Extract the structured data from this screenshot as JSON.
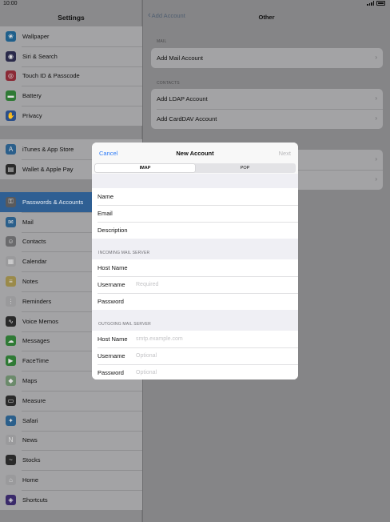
{
  "status": {
    "time": "10:00"
  },
  "sidebar": {
    "title": "Settings",
    "groups": [
      [
        {
          "label": "Wallpaper",
          "icon": "wallpaper-icon",
          "color": "#1f5f8b"
        },
        {
          "label": "Siri & Search",
          "icon": "siri-icon",
          "color": "#2a2a4a"
        },
        {
          "label": "Touch ID & Passcode",
          "icon": "fingerprint-icon",
          "color": "#8b2a36"
        },
        {
          "label": "Battery",
          "icon": "battery-icon",
          "color": "#2f7a35"
        },
        {
          "label": "Privacy",
          "icon": "hand-icon",
          "color": "#2b4f8b"
        }
      ],
      [
        {
          "label": "iTunes & App Store",
          "icon": "app-store-icon",
          "color": "#2b5f8b"
        },
        {
          "label": "Wallet & Apple Pay",
          "icon": "wallet-icon",
          "color": "#2a2a2a"
        }
      ],
      [
        {
          "label": "Passwords & Accounts",
          "icon": "key-icon",
          "color": "#5a5a5c"
        },
        {
          "label": "Mail",
          "icon": "mail-icon",
          "color": "#2b5f8b"
        },
        {
          "label": "Contacts",
          "icon": "contacts-icon",
          "color": "#6b6b6d"
        },
        {
          "label": "Calendar",
          "icon": "calendar-icon",
          "color": "#9a9a9c"
        },
        {
          "label": "Notes",
          "icon": "notes-icon",
          "color": "#9a8a4a"
        },
        {
          "label": "Reminders",
          "icon": "reminders-icon",
          "color": "#9a9a9c"
        },
        {
          "label": "Voice Memos",
          "icon": "voice-memos-icon",
          "color": "#2a2a2a"
        },
        {
          "label": "Messages",
          "icon": "messages-icon",
          "color": "#2f7a35"
        },
        {
          "label": "FaceTime",
          "icon": "facetime-icon",
          "color": "#2f7a35"
        },
        {
          "label": "Maps",
          "icon": "maps-icon",
          "color": "#6b8a6b"
        },
        {
          "label": "Measure",
          "icon": "measure-icon",
          "color": "#2a2a2a"
        },
        {
          "label": "Safari",
          "icon": "safari-icon",
          "color": "#2b5f8b"
        },
        {
          "label": "News",
          "icon": "news-icon",
          "color": "#9a9a9c"
        },
        {
          "label": "Stocks",
          "icon": "stocks-icon",
          "color": "#2a2a2a"
        },
        {
          "label": "Home",
          "icon": "home-icon",
          "color": "#9a9a9c"
        },
        {
          "label": "Shortcuts",
          "icon": "shortcuts-icon",
          "color": "#3a2a6a"
        }
      ]
    ],
    "selected": "Passwords & Accounts"
  },
  "detail": {
    "back_label": "Add Account",
    "title": "Other",
    "sections": [
      {
        "header": "MAIL",
        "rows": [
          "Add Mail Account"
        ]
      },
      {
        "header": "CONTACTS",
        "rows": [
          "Add LDAP Account",
          "Add CardDAV Account"
        ]
      }
    ]
  },
  "modal": {
    "cancel": "Cancel",
    "title": "New Account",
    "next": "Next",
    "segments": [
      "IMAP",
      "POP"
    ],
    "selected_segment": "IMAP",
    "account_rows": [
      "Name",
      "Email",
      "Description"
    ],
    "incoming": {
      "header": "INCOMING MAIL SERVER",
      "rows": [
        {
          "label": "Host Name",
          "placeholder": ""
        },
        {
          "label": "Username",
          "placeholder": "Required"
        },
        {
          "label": "Password",
          "placeholder": ""
        }
      ]
    },
    "outgoing": {
      "header": "OUTGOING MAIL SERVER",
      "rows": [
        {
          "label": "Host Name",
          "placeholder": "smtp.example.com"
        },
        {
          "label": "Username",
          "placeholder": "Optional"
        },
        {
          "label": "Password",
          "placeholder": "Optional"
        }
      ]
    }
  }
}
